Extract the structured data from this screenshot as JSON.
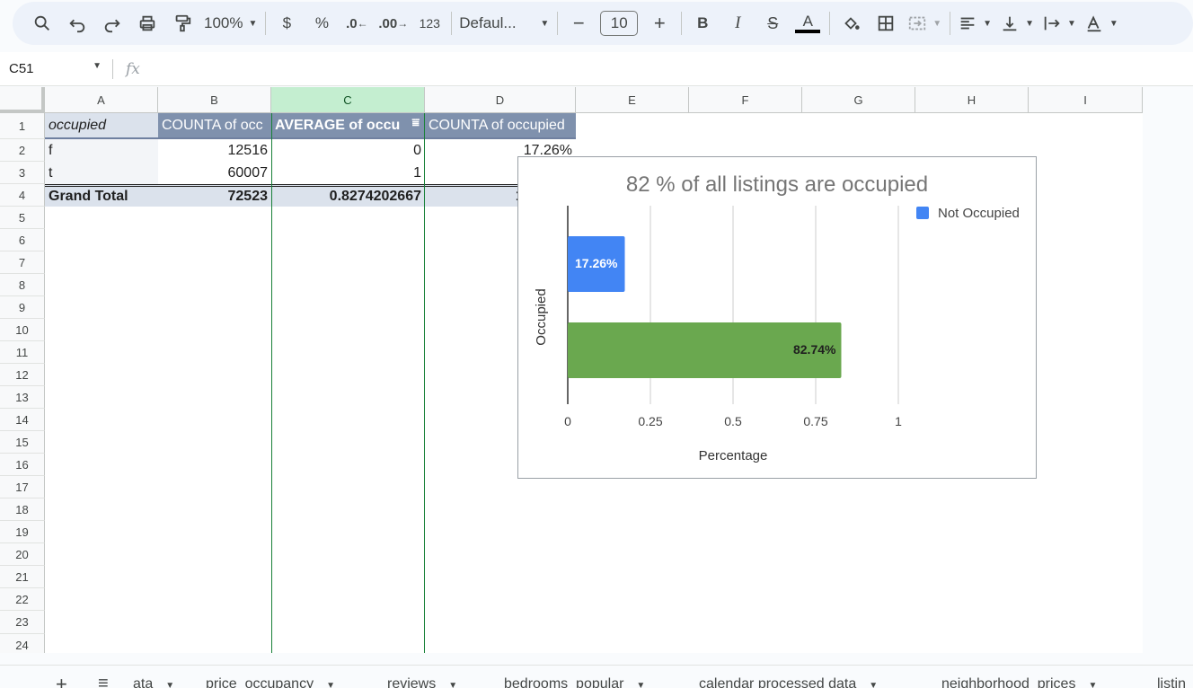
{
  "toolbar": {
    "zoom": "100%",
    "currency": "$",
    "percent": "%",
    "dec_decrease": ".0",
    "dec_increase": ".00",
    "number_format": "123",
    "font": "Defaul...",
    "font_size": "10",
    "bold": "B",
    "italic": "I",
    "text_color_glyph": "A"
  },
  "formula_bar": {
    "cell_ref": "C51",
    "fx": "fx"
  },
  "columns": [
    "A",
    "B",
    "C",
    "D",
    "E",
    "F",
    "G",
    "H",
    "I"
  ],
  "rows": [
    "1",
    "2",
    "3",
    "4",
    "5",
    "6",
    "7",
    "8",
    "9",
    "10",
    "11",
    "12",
    "13",
    "14",
    "15",
    "16",
    "17",
    "18",
    "19",
    "20",
    "21",
    "22",
    "23",
    "24"
  ],
  "pivot": {
    "header": [
      "occupied",
      "COUNTA of occ",
      "AVERAGE of occu",
      "COUNTA of occupied"
    ],
    "rows": [
      [
        "f",
        "12516",
        "0",
        "17.26%"
      ],
      [
        "t",
        "60007",
        "1",
        "82.74%"
      ]
    ],
    "total": [
      "Grand Total",
      "72523",
      "0.8274202667",
      "100.00%"
    ]
  },
  "chart_data": {
    "type": "bar",
    "orientation": "horizontal",
    "title": "82 % of all listings are occupied",
    "xlabel": "Percentage",
    "ylabel": "Occupied",
    "xlim": [
      0,
      1
    ],
    "xticks": [
      "0",
      "0.25",
      "0.5",
      "0.75",
      "1"
    ],
    "legend": "top-right",
    "series": [
      {
        "name": "Not Occupied",
        "value": 0.1726,
        "label": "17.26%",
        "color": "#4285f4"
      },
      {
        "value": 0.8274,
        "label": "82.74%",
        "color": "#6aa84f"
      }
    ]
  },
  "sheet_tabs": [
    "ata",
    "price_occupancy",
    "reviews",
    "bedrooms_popular",
    "calendar processed data",
    "neighborhood_prices",
    "listin"
  ]
}
